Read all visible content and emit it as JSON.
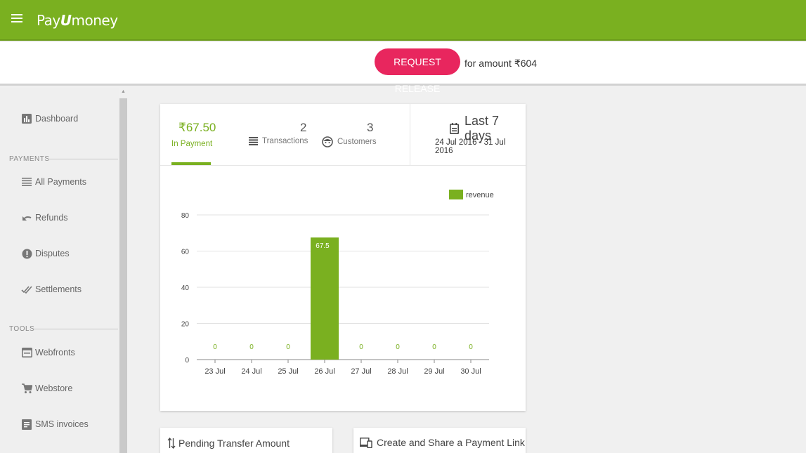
{
  "header": {
    "logo_prefix": "Pay",
    "logo_mark": "U",
    "logo_suffix": "money"
  },
  "release": {
    "button_label": "REQUEST RELEASE",
    "text": "for amount ₹604"
  },
  "sidebar": {
    "dashboard_label": "Dashboard",
    "payments_section": "PAYMENTS",
    "all_payments_label": "All Payments",
    "refunds_label": "Refunds",
    "disputes_label": "Disputes",
    "settlements_label": "Settlements",
    "tools_section": "TOOLS",
    "webfronts_label": "Webfronts",
    "webstore_label": "Webstore",
    "sms_invoices_label": "SMS invoices"
  },
  "stats": {
    "in_payment_amount": "₹67.50",
    "in_payment_label": "In Payment",
    "transactions_count": "2",
    "transactions_label": "Transactions",
    "customers_count": "3",
    "customers_label": "Customers",
    "range_title": "Last 7 days",
    "range_dates": "24 Jul 2016 - 31 Jul 2016"
  },
  "chart_data": {
    "type": "bar",
    "categories": [
      "23 Jul",
      "24 Jul",
      "25 Jul",
      "26 Jul",
      "27 Jul",
      "28 Jul",
      "29 Jul",
      "30 Jul"
    ],
    "series": [
      {
        "name": "revenue",
        "values": [
          0,
          0,
          0,
          67.5,
          0,
          0,
          0,
          0
        ],
        "color": "#7ab020"
      }
    ],
    "data_labels": [
      "0",
      "0",
      "0",
      "67.5",
      "0",
      "0",
      "0",
      "0"
    ],
    "yticks": [
      "0",
      "20",
      "40",
      "60",
      "80"
    ],
    "ylim": [
      0,
      80
    ],
    "grid": true,
    "legend_position": "top-right"
  },
  "cards": {
    "pending_transfer_title": "Pending Transfer Amount",
    "payment_link_title": "Create and Share a Payment Link"
  },
  "colors": {
    "brand_green": "#7ab020",
    "accent_pink": "#e8265e"
  }
}
